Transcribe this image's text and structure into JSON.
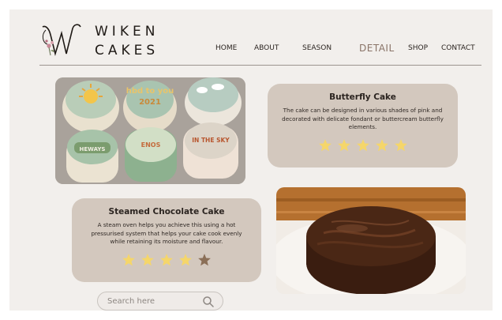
{
  "brand": {
    "line1": "WIKEN",
    "line2": "CAKES",
    "monogram": "W",
    "logo_icon": "floral-monogram-icon"
  },
  "nav": {
    "items": [
      {
        "label": "HOME",
        "active": false
      },
      {
        "label": "ABOUT",
        "active": false
      },
      {
        "label": "SEASON",
        "active": false
      },
      {
        "label": "DETAIL",
        "active": true
      },
      {
        "label": "SHOP",
        "active": false
      },
      {
        "label": "CONTACT",
        "active": false
      }
    ]
  },
  "products": [
    {
      "title": "Butterfly Cake",
      "description": "The cake can be designed in various shades of pink and decorated with delicate fondant or buttercream butterfly elements.",
      "rating": 5,
      "rating_max": 5,
      "photo": "cupcakes-photo"
    },
    {
      "title": "Steamed Chocolate Cake",
      "description": "A steam oven helps you achieve this using a hot pressurised system that helps your cake cook evenly while retaining its moisture and flavour.",
      "rating": 4,
      "rating_max": 5,
      "photo": "chocolate-cake-photo"
    }
  ],
  "cupcake_toppers": [
    "hbd to you",
    "2021",
    "HEWAYS",
    "ENOS",
    "IN THE SKY"
  ],
  "search": {
    "placeholder": "Search here",
    "value": ""
  },
  "colors": {
    "background": "#f2efec",
    "card": "#d3c8be",
    "star_filled": "#f5d66a",
    "star_empty": "#8b6f57",
    "nav_active": "#8a7468"
  }
}
